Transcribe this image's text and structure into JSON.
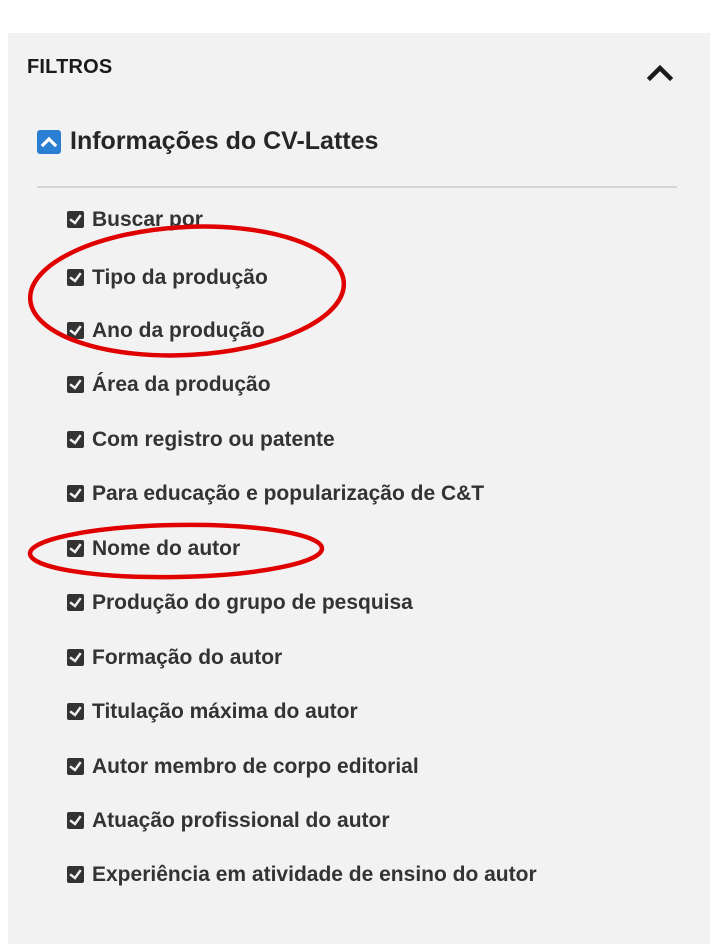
{
  "filters": {
    "title": "FILTROS",
    "collapse_icon": "chevron-up-icon"
  },
  "section": {
    "title": "Informações do CV-Lattes",
    "toggle_icon": "chevron-up-square-icon",
    "accent_color": "#2b7fd3"
  },
  "items": [
    {
      "label": "Buscar por"
    },
    {
      "label": "Tipo da produção"
    },
    {
      "label": "Ano da produção"
    },
    {
      "label": "Área da produção"
    },
    {
      "label": "Com registro ou patente"
    },
    {
      "label": "Para educação e popularização de C&T"
    },
    {
      "label": "Nome do autor"
    },
    {
      "label": "Produção do grupo de pesquisa"
    },
    {
      "label": "Formação do autor"
    },
    {
      "label": "Titulação máxima do autor"
    },
    {
      "label": "Autor membro de corpo editorial"
    },
    {
      "label": "Atuação profissional do autor"
    },
    {
      "label": "Experiência em atividade de ensino do autor"
    }
  ],
  "item_icon": "checked-checkbox-icon",
  "annotation_color": "#e00000"
}
